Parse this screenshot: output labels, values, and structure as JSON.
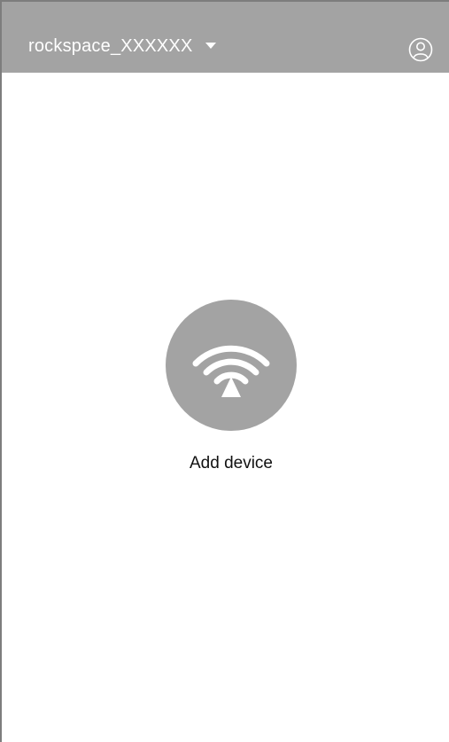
{
  "header": {
    "network_name": "rockspace_XXXXXX",
    "dropdown_icon": "caret-down-icon",
    "profile_icon": "user-profile-icon"
  },
  "main": {
    "add_device_label": "Add device",
    "add_device_icon": "wifi-signal-icon"
  },
  "colors": {
    "header_bg": "#a3a3a3",
    "circle_bg": "#a3a3a3",
    "header_text": "#ffffff",
    "body_text": "#111111",
    "background": "#ffffff"
  }
}
